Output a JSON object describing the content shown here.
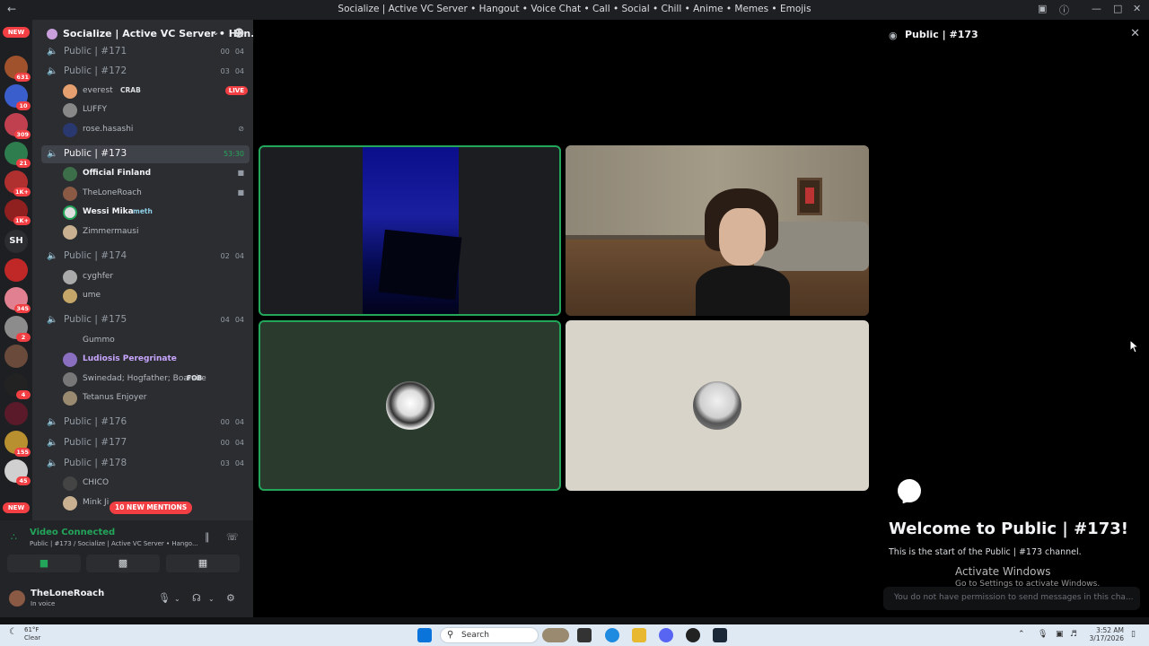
{
  "window": {
    "title": "Socialize | Active VC Server • Hangout • Voice Chat • Call • Social • Chill • Anime • Memes • Emojis"
  },
  "rail": {
    "new_top": "NEW",
    "new_bottom": "NEW",
    "letters_server": "SH",
    "badges": [
      "631",
      "10",
      "309",
      "21",
      "1K+",
      "1K+",
      "345",
      "2",
      "4",
      "155",
      "45"
    ]
  },
  "server": {
    "name": "Socialize | Active VC Server • Han..."
  },
  "channels": [
    {
      "name": "Public | #171",
      "count": "00",
      "limit": "04",
      "active": false
    },
    {
      "name": "Public | #172",
      "count": "03",
      "limit": "04",
      "active": true
    },
    {
      "name": "Public | #173",
      "time": "53:30",
      "active": true,
      "selected": true
    },
    {
      "name": "Public | #174",
      "count": "02",
      "limit": "04",
      "active": true
    },
    {
      "name": "Public | #175",
      "count": "04",
      "limit": "04",
      "active": true
    },
    {
      "name": "Public | #176",
      "count": "00",
      "limit": "04",
      "active": false
    },
    {
      "name": "Public | #177",
      "count": "00",
      "limit": "04",
      "active": false
    },
    {
      "name": "Public | #178",
      "count": "03",
      "limit": "04",
      "active": true
    }
  ],
  "users": {
    "c172": [
      {
        "name": "everest",
        "tag": "CRAB",
        "live": "LIVE"
      },
      {
        "name": "LUFFY"
      },
      {
        "name": "rose.hasashi"
      }
    ],
    "c173": [
      {
        "name": "Official Finland"
      },
      {
        "name": "TheLoneRoach"
      },
      {
        "name": "Wessi Mika",
        "tag": "meth"
      },
      {
        "name": "Zimmermausi"
      }
    ],
    "c174": [
      {
        "name": "cyghfer"
      },
      {
        "name": "ume"
      }
    ],
    "c175": [
      {
        "name": "Gummo"
      },
      {
        "name": "Ludiosis Peregrinate"
      },
      {
        "name": "Swinedad; Hogfather; Boarsire",
        "tag": "FOB"
      },
      {
        "name": "Tetanus Enjoyer"
      }
    ],
    "c178": [
      {
        "name": "CHICO"
      },
      {
        "name": "Mink Ji"
      }
    ]
  },
  "mentions": "10 NEW MENTIONS",
  "voice": {
    "status": "Video Connected",
    "location": "Public | #173 / Socialize | Active VC Server • Hango..."
  },
  "me": {
    "name": "TheLoneRoach",
    "status": "In voice"
  },
  "chat": {
    "header": "Public | #173",
    "welcome": "Welcome to Public | #173!",
    "start": "This is the start of the Public | #173 channel.",
    "activate_title": "Activate Windows",
    "activate_sub": "Go to Settings to activate Windows.",
    "no_permission": "You do not have permission to send messages in this cha..."
  },
  "taskbar": {
    "temp": "61°F",
    "weather": "Clear",
    "search": "Search",
    "time": "3:52 AM",
    "date": "3/17/2026"
  },
  "colors": {
    "green": "#23a55a",
    "red": "#f23f43",
    "sidebar": "#2b2d31",
    "selected": "#404249"
  }
}
